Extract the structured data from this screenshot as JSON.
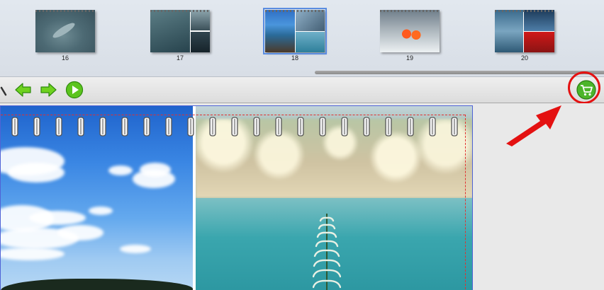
{
  "thumbnails": [
    {
      "number": "16",
      "selected": false
    },
    {
      "number": "17",
      "selected": false
    },
    {
      "number": "18",
      "selected": true
    },
    {
      "number": "19",
      "selected": false
    },
    {
      "number": "20",
      "selected": false
    }
  ],
  "toolbar": {
    "icons": [
      "zoom-icon",
      "arrow-left-icon",
      "arrow-right-icon",
      "play-icon",
      "shopping-cart-icon"
    ]
  },
  "annotation": {
    "color": "#e41111"
  },
  "colors": {
    "accent_green": "#2aa52a",
    "selection_blue": "#5a8ce0",
    "bleed_line": "#e23030"
  }
}
